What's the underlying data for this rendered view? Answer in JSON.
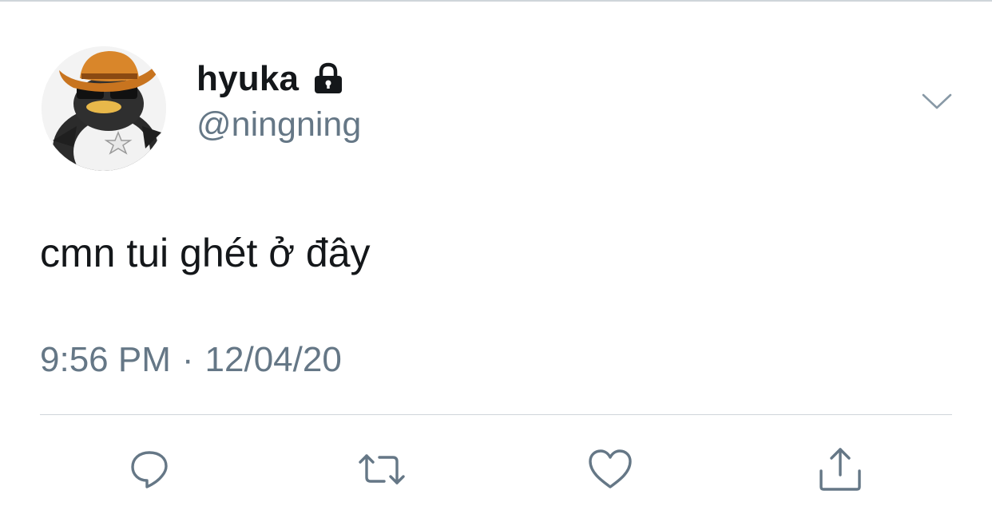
{
  "tweet": {
    "author": {
      "display_name": "hyuka",
      "handle": "@ningning",
      "protected_icon": "lock-icon",
      "avatar": "penguin-avatar"
    },
    "text": "cmn tui ghét ở đây",
    "time": "9:56 PM",
    "separator": "·",
    "date": "12/04/20",
    "menu_icon": "chevron-down-icon",
    "actions": [
      {
        "icon": "reply-icon"
      },
      {
        "icon": "retweet-icon"
      },
      {
        "icon": "like-icon"
      },
      {
        "icon": "share-icon"
      }
    ]
  },
  "colors": {
    "text_primary": "#14171a",
    "text_secondary": "#657786",
    "icon": "#657786",
    "divider": "#cfd5da",
    "background": "#ffffff"
  }
}
